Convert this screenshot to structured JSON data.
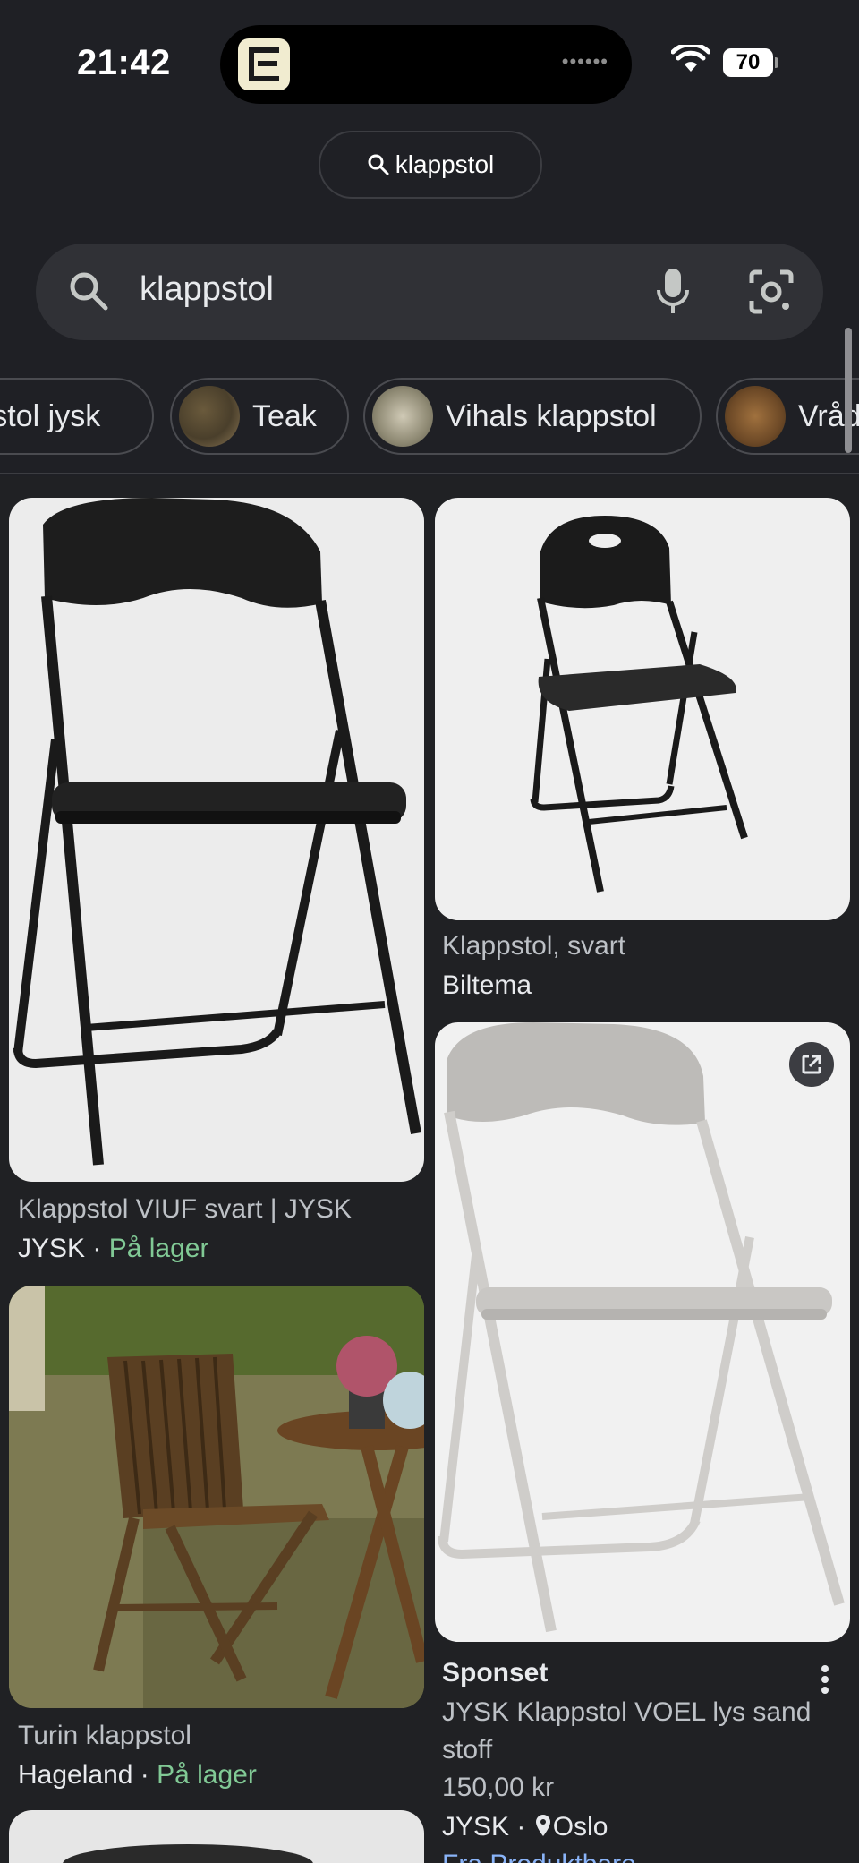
{
  "status_bar": {
    "time": "21:42",
    "battery": "70",
    "island_indicator": "••••••"
  },
  "query_pill": {
    "label": "klappstol"
  },
  "search": {
    "value": "klappstol",
    "icons": [
      "search-icon",
      "mic-icon",
      "lens-icon"
    ]
  },
  "chips": [
    {
      "label": "klappstol jysk"
    },
    {
      "label": "Teak"
    },
    {
      "label": "Vihals klappstol"
    },
    {
      "label": "Vrådal"
    }
  ],
  "results": {
    "left": [
      {
        "title": "Klappstol VIUF svart | JYSK",
        "source": "JYSK",
        "availability": "På lager"
      },
      {
        "title": "Turin klappstol",
        "source": "Hageland",
        "availability": "På lager"
      }
    ],
    "right": [
      {
        "title": "Klappstol, svart",
        "source": "Biltema"
      },
      {
        "sponsored": "Sponset",
        "title": "JYSK Klappstol VOEL lys sand stoff",
        "price": "150,00 kr",
        "source": "JYSK",
        "location": "Oslo",
        "extra": "Fra Produktbare"
      }
    ],
    "separator": " · "
  },
  "colors": {
    "background": "#1f2025",
    "surface": "#303136",
    "availability_green": "#81c995",
    "link_blue": "#8ab4f8"
  }
}
